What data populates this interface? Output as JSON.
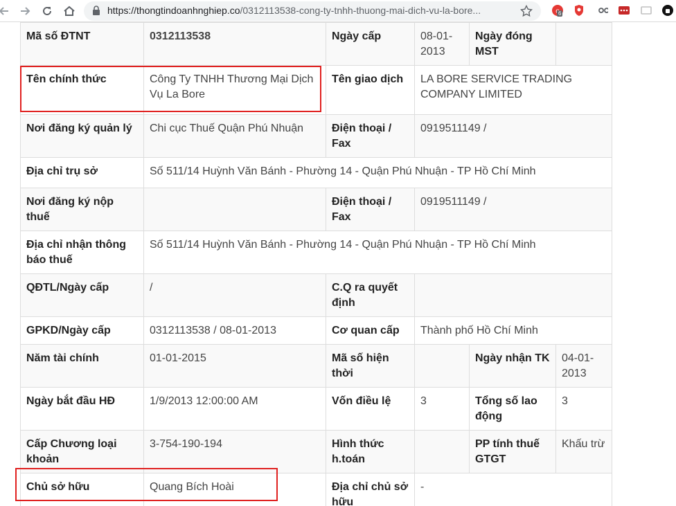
{
  "browser": {
    "url_host": "https://thongtindoanhnghiep.co",
    "url_path": "/0312113538-cong-ty-tnhh-thuong-mai-dich-vu-la-bore...",
    "badge_count": "6"
  },
  "table": {
    "r1": {
      "l1": "Mã số ĐTNT",
      "v1": "0312113538",
      "l2": "Ngày cấp",
      "v2": "08-01-2013",
      "l3": "Ngày đóng MST",
      "v3": ""
    },
    "r2": {
      "l1": "Tên chính thức",
      "v1": "Công Ty TNHH Thương Mại Dịch Vụ La Bore",
      "l2": "Tên giao dịch",
      "v2": "LA BORE SERVICE TRADING COMPANY LIMITED"
    },
    "r3": {
      "l1": "Nơi đăng ký quản lý",
      "v1": "Chi cục Thuế Quận Phú Nhuận",
      "l2": "Điện thoại / Fax",
      "v2": "0919511149 /"
    },
    "r4": {
      "l1": "Địa chỉ trụ sở",
      "v1": "Số 511/14 Huỳnh Văn Bánh - Phường 14 - Quận Phú Nhuận - TP Hồ Chí Minh"
    },
    "r5": {
      "l1": "Nơi đăng ký nộp thuế",
      "v1": "",
      "l2": "Điện thoại / Fax",
      "v2": "0919511149 /"
    },
    "r6": {
      "l1": "Địa chỉ nhận thông báo thuế",
      "v1": "Số 511/14 Huỳnh Văn Bánh - Phường 14 - Quận Phú Nhuận - TP Hồ Chí Minh"
    },
    "r7": {
      "l1": "QĐTL/Ngày cấp",
      "v1": "/",
      "l2": "C.Q ra quyết định",
      "v2": ""
    },
    "r8": {
      "l1": "GPKD/Ngày cấp",
      "v1": "0312113538 / 08-01-2013",
      "l2": "Cơ quan cấp",
      "v2": "Thành phố Hồ Chí Minh"
    },
    "r9": {
      "l1": "Năm tài chính",
      "v1": "01-01-2015",
      "l2": "Mã số hiện thời",
      "v2": "",
      "l3": "Ngày nhận TK",
      "v3": "04-01-2013"
    },
    "r10": {
      "l1": "Ngày bắt đầu HĐ",
      "v1": "1/9/2013 12:00:00 AM",
      "l2": "Vốn điều lệ",
      "v2": "3",
      "l3": "Tổng số lao động",
      "v3": "3"
    },
    "r11": {
      "l1": "Cấp Chương loại khoản",
      "v1": "3-754-190-194",
      "l2": "Hình thức h.toán",
      "v2": "",
      "l3": "PP tính thuế GTGT",
      "v3": "Khấu trừ"
    },
    "r12": {
      "l1": "Chủ sở hữu",
      "v1": "Quang Bích Hoài",
      "l2": "Địa chỉ chủ sở hữu",
      "v2": "-"
    }
  }
}
